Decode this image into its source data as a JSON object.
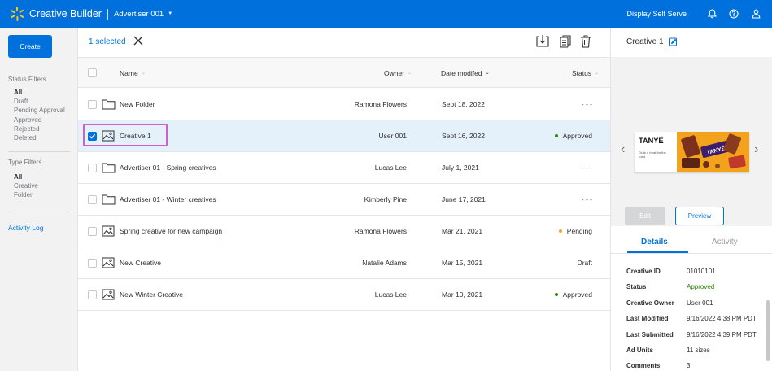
{
  "header": {
    "app_title": "Creative Builder",
    "account": "Advertiser 001",
    "display_self_serve": "Display Self Serve",
    "icons": [
      "bell-icon",
      "help-icon",
      "user-icon"
    ],
    "brand_color": "#0071dc",
    "spark_color": "#ffc220"
  },
  "sidebar": {
    "create_label": "Create",
    "status_filters_title": "Status Filters",
    "status_filters": [
      "All",
      "Draft",
      "Pending Approval",
      "Approved",
      "Rejected",
      "Deleted"
    ],
    "type_filters_title": "Type Filters",
    "type_filters": [
      "All",
      "Creative",
      "Folder"
    ],
    "activity_log": "Activity Log"
  },
  "toolbar": {
    "selected_text": "1 selected",
    "icons": [
      "download-icon",
      "copy-icon",
      "trash-icon"
    ]
  },
  "table": {
    "columns": {
      "name": "Name",
      "owner": "Owner",
      "date": "Date modifed",
      "status": "Status"
    },
    "rows": [
      {
        "type": "folder",
        "name": "New Folder",
        "owner": "Ramona Flowers",
        "date": "Sept 18, 2022",
        "status": "- - -",
        "status_color": ""
      },
      {
        "type": "creative",
        "name": "Creative 1",
        "owner": "User 001",
        "date": "Sept 16, 2022",
        "status": "Approved",
        "status_color": "#2a8703",
        "selected": true
      },
      {
        "type": "folder",
        "name": "Advertiser 01 - Spring creatives",
        "owner": "Lucas Lee",
        "date": "July 1, 2021",
        "status": "- - -",
        "status_color": ""
      },
      {
        "type": "folder",
        "name": "Advertiser 01 - Winter creatives",
        "owner": "Kimberly Pine",
        "date": "June 17, 2021",
        "status": "- - -",
        "status_color": ""
      },
      {
        "type": "creative",
        "name": "Spring creative for new campaign",
        "owner": "Ramona Flowers",
        "date": "Mar 21, 2021",
        "status": "Pending",
        "status_color": "#f5a623"
      },
      {
        "type": "creative",
        "name": "New Creative",
        "owner": "Natalie Adams",
        "date": "Mar 15, 2021",
        "status": "Draft",
        "status_color": ""
      },
      {
        "type": "creative",
        "name": "New Winter Creative",
        "owner": "Lucas Lee",
        "date": "Mar 10, 2021",
        "status": "Approved",
        "status_color": "#2a8703"
      }
    ]
  },
  "panel": {
    "title": "Creative 1",
    "banner_brand": "TANYÉ",
    "banner_tagline": "Grab a treat for the road",
    "edit_label": "Edit",
    "preview_label": "Preview",
    "tab_details": "Details",
    "tab_activity": "Activity",
    "details": [
      {
        "label": "Creative ID",
        "value": "01010101",
        "color": ""
      },
      {
        "label": "Status",
        "value": "Approved",
        "color": "#2a8703"
      },
      {
        "label": "Creative Owner",
        "value": "User 001",
        "color": ""
      },
      {
        "label": "Last Modified",
        "value": "9/16/2022 4:38 PM PDT",
        "color": ""
      },
      {
        "label": "Last Submitted",
        "value": "9/16/2022 4:39 PM PDT",
        "color": ""
      },
      {
        "label": "Ad Units",
        "value": "11 sizes",
        "color": ""
      },
      {
        "label": "Comments",
        "value": "3",
        "color": ""
      }
    ]
  }
}
